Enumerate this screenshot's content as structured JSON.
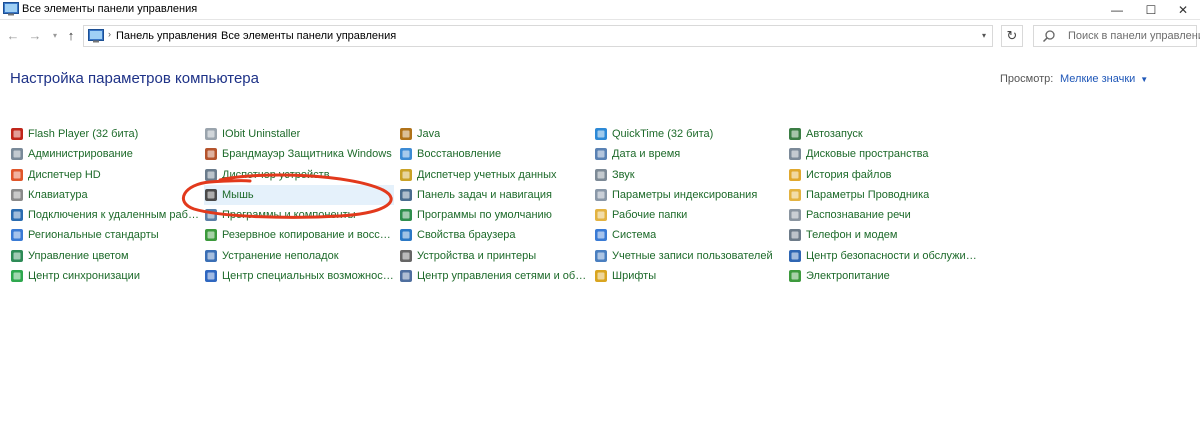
{
  "window": {
    "title": "Все элементы панели управления",
    "controls": {
      "minimize": "—",
      "maximize": "☐",
      "close": "✕"
    }
  },
  "address_bar": {
    "back": "←",
    "forward": "→",
    "history": "▾",
    "up": "↑",
    "separator": "›",
    "breadcrumbs": [
      "Панель управления",
      "Все элементы панели управления"
    ],
    "dropdown": "▾",
    "refresh": "↻",
    "search_placeholder": "Поиск в панели управления"
  },
  "header": {
    "title": "Настройка параметров компьютера",
    "view_label": "Просмотр:",
    "view_value": "Мелкие значки",
    "view_caret": "▼"
  },
  "columns": [
    [
      {
        "label": "Flash Player (32 бита)",
        "icon": "flash-icon",
        "color": "#c0261b"
      },
      {
        "label": "Администрирование",
        "icon": "admin-tools-icon",
        "color": "#7a8a99"
      },
      {
        "label": "Диспетчер HD",
        "icon": "hd-manager-icon",
        "color": "#e0562a"
      },
      {
        "label": "Клавиатура",
        "icon": "keyboard-icon",
        "color": "#8a8a8a"
      },
      {
        "label": "Подключения к удаленным рабоч...",
        "icon": "remote-connection-icon",
        "color": "#2b6cb0"
      },
      {
        "label": "Региональные стандарты",
        "icon": "region-icon",
        "color": "#3a7bd5"
      },
      {
        "label": "Управление цветом",
        "icon": "color-management-icon",
        "color": "#2e8b57"
      },
      {
        "label": "Центр синхронизации",
        "icon": "sync-center-icon",
        "color": "#2fa84f"
      }
    ],
    [
      {
        "label": "IObit Uninstaller",
        "icon": "uninstaller-icon",
        "color": "#9aa4ad"
      },
      {
        "label": "Брандмауэр Защитника Windows",
        "icon": "firewall-icon",
        "color": "#b5542d"
      },
      {
        "label": "Диспетчер устройств",
        "icon": "device-manager-icon",
        "color": "#6b7c8c"
      },
      {
        "label": "Мышь",
        "icon": "mouse-icon",
        "color": "#4a4a4a"
      },
      {
        "label": "Программы и компоненты",
        "icon": "programs-icon",
        "color": "#5a7fa6"
      },
      {
        "label": "Резервное копирование и восстан...",
        "icon": "backup-icon",
        "color": "#3c9a3c"
      },
      {
        "label": "Устранение неполадок",
        "icon": "troubleshoot-icon",
        "color": "#3b6fb5"
      },
      {
        "label": "Центр специальных возможностей",
        "icon": "accessibility-icon",
        "color": "#2f67c0"
      }
    ],
    [
      {
        "label": "Java",
        "icon": "java-icon",
        "color": "#b07219"
      },
      {
        "label": "Восстановление",
        "icon": "recovery-icon",
        "color": "#3d8bd4"
      },
      {
        "label": "Диспетчер учетных данных",
        "icon": "credential-manager-icon",
        "color": "#c9a227"
      },
      {
        "label": "Панель задач и навигация",
        "icon": "taskbar-icon",
        "color": "#4a6d8f"
      },
      {
        "label": "Программы по умолчанию",
        "icon": "default-programs-icon",
        "color": "#2f8f4e"
      },
      {
        "label": "Свойства браузера",
        "icon": "browser-properties-icon",
        "color": "#2b78c5"
      },
      {
        "label": "Устройства и принтеры",
        "icon": "printers-icon",
        "color": "#666666"
      },
      {
        "label": "Центр управления сетями и общи...",
        "icon": "network-center-icon",
        "color": "#4f6f9f"
      }
    ],
    [
      {
        "label": "QuickTime (32 бита)",
        "icon": "quicktime-icon",
        "color": "#2d89d6"
      },
      {
        "label": "Дата и время",
        "icon": "clock-icon",
        "color": "#5a82b4"
      },
      {
        "label": "Звук",
        "icon": "sound-icon",
        "color": "#7d8a96"
      },
      {
        "label": "Параметры индексирования",
        "icon": "indexing-icon",
        "color": "#8a98a8"
      },
      {
        "label": "Рабочие папки",
        "icon": "work-folders-icon",
        "color": "#e3b341"
      },
      {
        "label": "Система",
        "icon": "system-icon",
        "color": "#3a7bd5"
      },
      {
        "label": "Учетные записи пользователей",
        "icon": "user-accounts-icon",
        "color": "#4a7fc0"
      },
      {
        "label": "Шрифты",
        "icon": "fonts-icon",
        "color": "#d9a520"
      }
    ],
    [
      {
        "label": "Автозапуск",
        "icon": "autoplay-icon",
        "color": "#3a7d44"
      },
      {
        "label": "Дисковые пространства",
        "icon": "storage-spaces-icon",
        "color": "#7c8a99"
      },
      {
        "label": "История файлов",
        "icon": "file-history-icon",
        "color": "#e0a82e"
      },
      {
        "label": "Параметры Проводника",
        "icon": "explorer-options-icon",
        "color": "#e3b341"
      },
      {
        "label": "Распознавание речи",
        "icon": "speech-icon",
        "color": "#8a95a0"
      },
      {
        "label": "Телефон и модем",
        "icon": "phone-modem-icon",
        "color": "#6d7b89"
      },
      {
        "label": "Центр безопасности и обслуживан...",
        "icon": "security-center-icon",
        "color": "#2f66b3"
      },
      {
        "label": "Электропитание",
        "icon": "power-icon",
        "color": "#3d9a3d"
      }
    ]
  ],
  "colors": {
    "heading": "#1e3287",
    "link": "#1d6a2a",
    "accent": "#1f57b8",
    "annotation": "#e2391c",
    "highlight": "#e5f1fb"
  }
}
